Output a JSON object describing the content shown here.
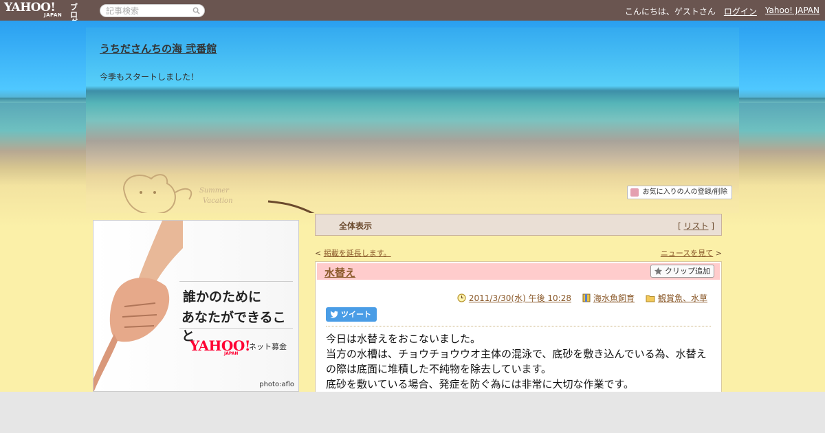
{
  "topbar": {
    "logo_main": "YAHOO!",
    "logo_sub": "JAPAN",
    "logo_blog": "ブログ",
    "search_placeholder": "記事検索",
    "greeting": "こんにちは、ゲストさん",
    "login": "ログイン",
    "yahoo_japan": "Yahoo! JAPAN"
  },
  "header": {
    "title": "うちださんちの海 弐番館",
    "description": "今季もスタートしました！",
    "fav_button": "お気に入りの人の登録/削除"
  },
  "ad": {
    "line1": "誰かのために",
    "line2": "あなたができること",
    "logo": "YAHOO!",
    "logo_sub": "JAPAN",
    "fund": "ネット募金",
    "credit": "photo:aflo"
  },
  "category_bar": {
    "all": "全体表示",
    "list_prefix": "[ ",
    "list": "リスト",
    "list_suffix": " ]"
  },
  "pager": {
    "prev_mark": "< ",
    "prev": "掲載を延長します。",
    "next": "ニュースを見て",
    "next_mark": " >"
  },
  "post": {
    "title": "水替え",
    "clip": "クリップ追加",
    "date": "2011/3/30(水) 午後 10:28",
    "book_category": "海水魚飼育",
    "folder": "観賞魚、水草",
    "tweet": "ツイート",
    "lines": [
      "今日は水替えをおこないました。",
      "当方の水槽は、チョウチョウウオ主体の混泳で、底砂を敷き込んでいる為、水替えの際は底面に堆積した不純物を除去しています。",
      "底砂を敷いている場合、発症を防ぐ為には非常に大切な作業です。"
    ]
  }
}
